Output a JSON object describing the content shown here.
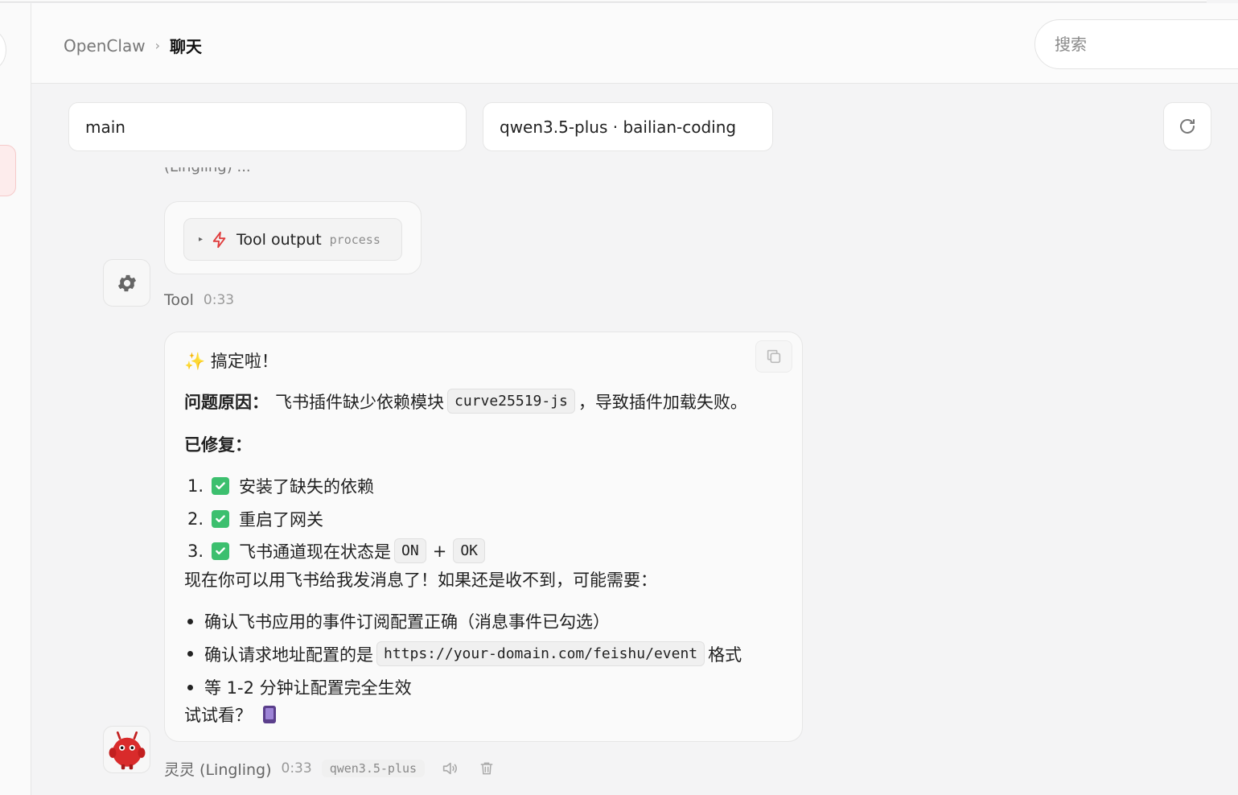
{
  "header": {
    "breadcrumb_root": "OpenClaw",
    "breadcrumb_sep": "›",
    "breadcrumb_current": "聊天",
    "search_placeholder": "搜索"
  },
  "selectors": {
    "agent": "main",
    "model": "qwen3.5-plus · bailian-coding"
  },
  "tool_message": {
    "cut_text": "(Lingling) ... ",
    "pill_label": "Tool output",
    "pill_tag": "process",
    "sender": "Tool",
    "time": "0:33"
  },
  "assistant_message": {
    "line_greeting": "✨ 搞定啦！",
    "cause_label": "问题原因：",
    "cause_text_a": "飞书插件缺少依赖模块",
    "cause_code": "curve25519-js",
    "cause_text_b": "，导致插件加载失败。",
    "fixed_label": "已修复：",
    "fixed_items": [
      {
        "num": "1.",
        "text": "安装了缺失的依赖"
      },
      {
        "num": "2.",
        "text": "重启了网关"
      },
      {
        "num": "3.",
        "text": "飞书通道现在状态是"
      }
    ],
    "status_on": "ON",
    "status_plus": "+",
    "status_ok": "OK",
    "intro": "现在你可以用飞书给我发消息了！如果还是收不到，可能需要：",
    "bullets": [
      "确认飞书应用的事件订阅配置正确（消息事件已勾选）",
      "确认请求地址配置的是",
      "等 1-2 分钟让配置完全生效"
    ],
    "bullet2_code": "https://your-domain.com/feishu/event",
    "bullet2_suffix": "格式",
    "closing": "试试看？",
    "sender": "灵灵 (Lingling)",
    "time": "0:33",
    "model_tag": "qwen3.5-plus"
  },
  "icons": {
    "tool_avatar": "gear-icon",
    "bot_avatar": "red-mascot-icon",
    "tool_pill": "lightning-icon",
    "copy": "copy-icon",
    "speak": "speaker-icon",
    "delete": "trash-icon",
    "refresh": "refresh-icon"
  },
  "colors": {
    "accent_red": "#e03c3c",
    "check_green": "#3cbf6e"
  }
}
